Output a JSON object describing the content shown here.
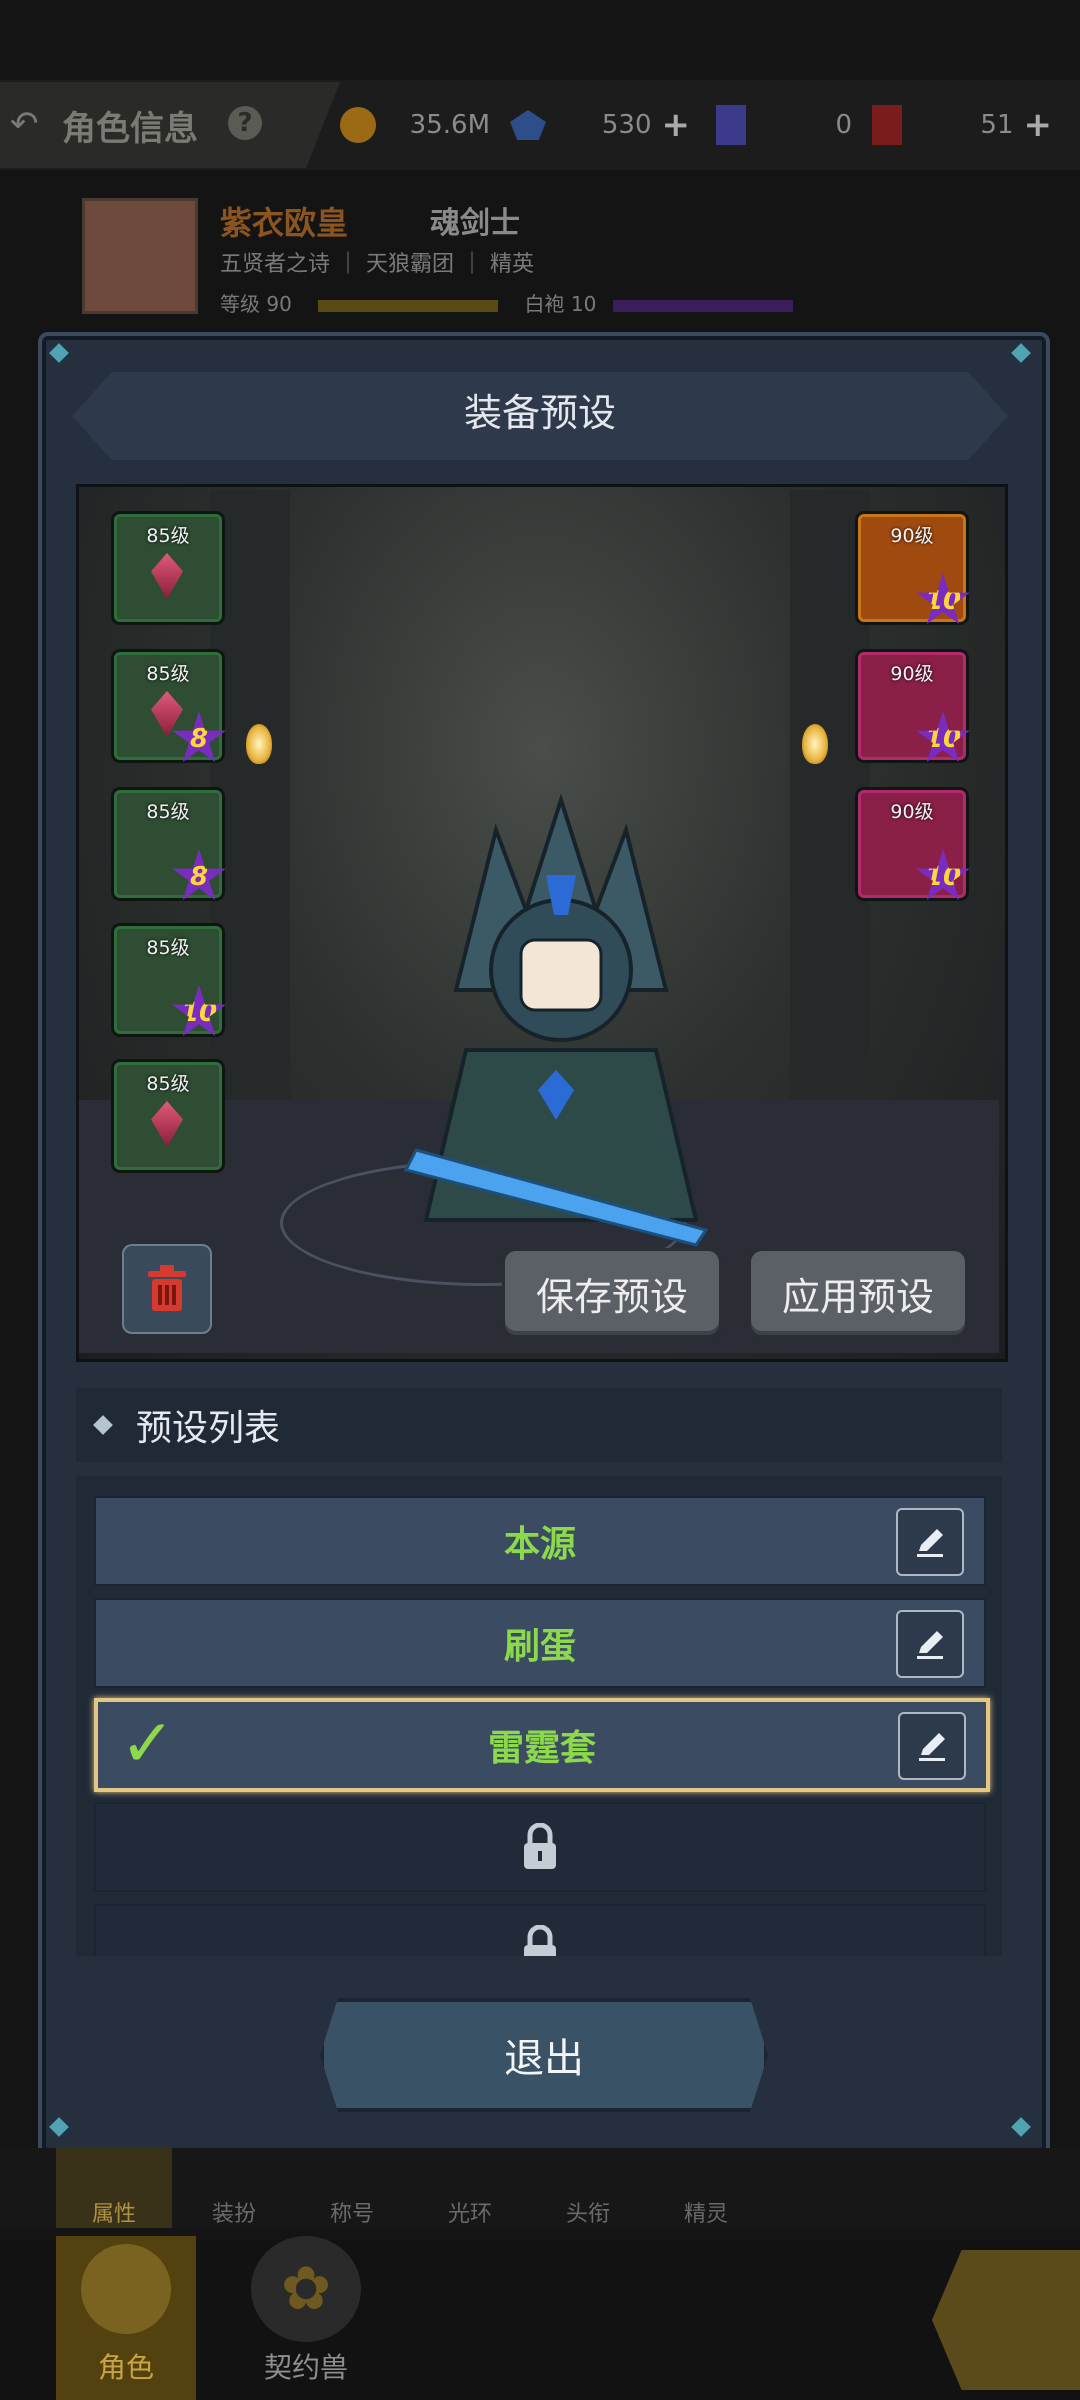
{
  "header": {
    "title": "角色信息",
    "help_icon": "question-icon",
    "gold": "35.6M",
    "crystal": "530",
    "ticket1": "0",
    "ticket2": "51"
  },
  "profile": {
    "name": "紫衣欧皇",
    "class": "魂剑士",
    "subtitle": "五贤者之诗",
    "guild": "天狼霸团",
    "rank": "精英",
    "level": "等级 90",
    "robe": "白袍 10"
  },
  "dialog": {
    "title": "装备预设",
    "save_label": "保存预设",
    "apply_label": "应用预设",
    "list_title": "预设列表",
    "exit_label": "退出"
  },
  "left_slots": [
    {
      "level": "85级",
      "star": ""
    },
    {
      "level": "85级",
      "star": "8"
    },
    {
      "level": "85级",
      "star": "8"
    },
    {
      "level": "85级",
      "star": "10"
    },
    {
      "level": "85级",
      "star": ""
    }
  ],
  "right_slots": [
    {
      "level": "90级",
      "star": "10"
    },
    {
      "level": "90级",
      "star": "10"
    },
    {
      "level": "90级",
      "star": "10"
    }
  ],
  "presets": [
    {
      "name": "本源",
      "selected": false
    },
    {
      "name": "刷蛋",
      "selected": false
    },
    {
      "name": "雷霆套",
      "selected": true
    }
  ],
  "tabs": [
    "属性",
    "装扮",
    "称号",
    "光环",
    "头衔",
    "精灵"
  ],
  "bottom_nav": [
    "角色",
    "契约兽"
  ],
  "colors": {
    "accent": "#8cd94b",
    "selected_border": "#e6c684",
    "dialog_bg": "#252f3e"
  }
}
